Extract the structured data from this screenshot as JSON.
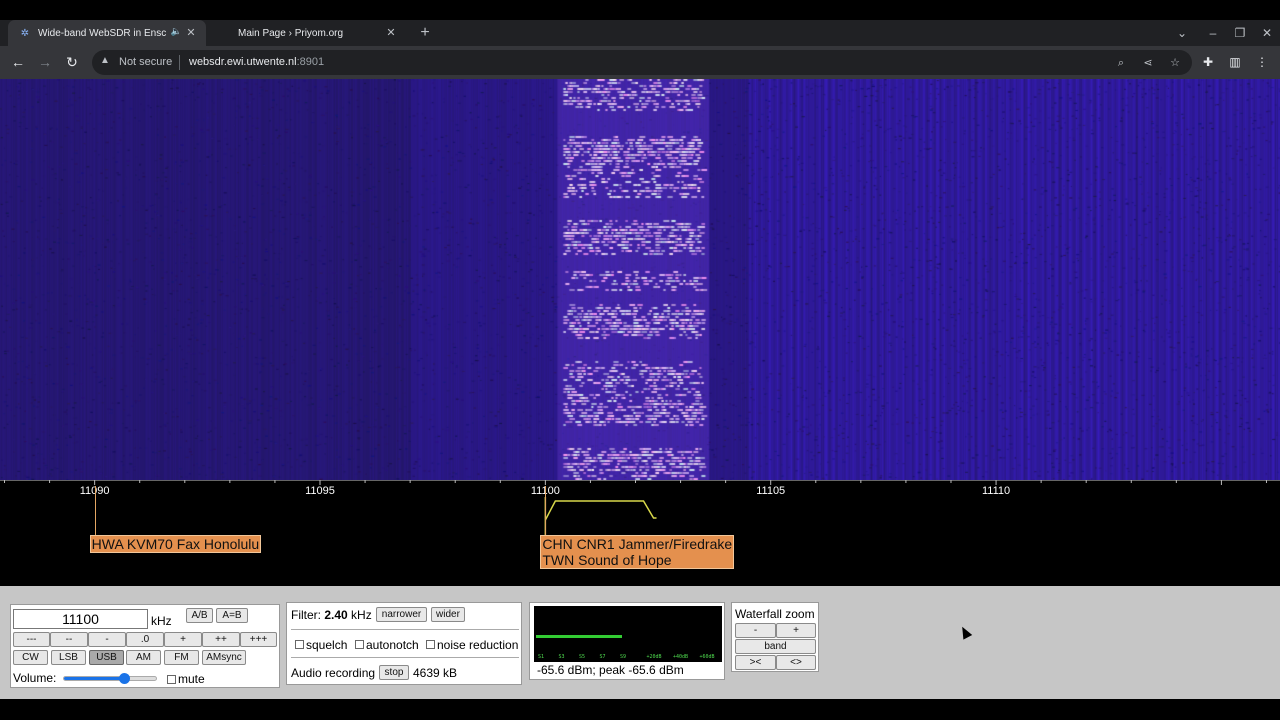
{
  "browser": {
    "tabs": [
      {
        "title": "Wide-band WebSDR in Ensch",
        "active": true,
        "audio": true
      },
      {
        "title": "Main Page › Priyom.org",
        "active": false
      }
    ],
    "address": {
      "security_label": "Not secure",
      "host": "websdr.ewi.utwente.nl",
      "port": ":8901"
    },
    "icons": {
      "back": "arrow-left-icon",
      "forward": "arrow-right-icon",
      "reload": "reload-icon",
      "zoom": "zoom-icon",
      "share": "share-icon",
      "bookmark": "star-icon",
      "extensions": "puzzle-icon",
      "sidepanel": "side-panel-icon",
      "menu": "kebab-menu-icon"
    }
  },
  "waterfall": {
    "freq_min": 11087.9,
    "freq_max": 11116.3,
    "colors": {
      "background": "#1d1a55",
      "signal": "#c89af2",
      "band": "#4a1fc4"
    },
    "signal_band_khz": [
      11100.4,
      11103.5
    ],
    "bright_zone_khz": [
      11104.5,
      11116.3
    ]
  },
  "scale": {
    "ticks": [
      "11090",
      "11095",
      "11100",
      "11105",
      "11110"
    ],
    "tick_values": [
      11090,
      11095,
      11100,
      11105,
      11110
    ],
    "passband_khz": [
      11100,
      11102.4
    ],
    "stations": [
      {
        "freq": 11090,
        "lines": [
          "HWA KVM70 Fax Honolulu"
        ]
      },
      {
        "freq": 11100,
        "lines": [
          "CHN CNR1 Jammer/Firedrake",
          "TWN Sound of Hope"
        ]
      }
    ]
  },
  "controls": {
    "frequency": "11100",
    "unit": "kHz",
    "ab_button": "A/B",
    "aeqb_button": "A=B",
    "step_buttons": [
      "---",
      "--",
      "-",
      ".0",
      "+",
      "++",
      "+++"
    ],
    "modes": [
      "CW",
      "LSB",
      "USB",
      "AM",
      "FM",
      "AMsync"
    ],
    "active_mode": "USB",
    "volume_label": "Volume:",
    "volume_level": 0.65,
    "mute_label": "mute"
  },
  "filter": {
    "label": "Filter:",
    "value": "2.40",
    "unit": "kHz",
    "narrower": "narrower",
    "wider": "wider",
    "squelch": "squelch",
    "autonotch": "autonotch",
    "noise_reduction": "noise reduction",
    "recording_label": "Audio recording",
    "stop": "stop",
    "size": "4639 kB"
  },
  "smeter": {
    "reading": "-65.6 dBm; peak  -65.6 dBm",
    "level": 0.47,
    "scale": [
      "S1",
      "S3",
      "S5",
      "S7",
      "S9",
      "+20dB",
      "+40dB",
      "+60dB"
    ]
  },
  "zoom": {
    "title": "Waterfall zoom",
    "minus": "-",
    "plus": "+",
    "band": "band",
    "narrow": "><",
    "wide": "<>"
  }
}
